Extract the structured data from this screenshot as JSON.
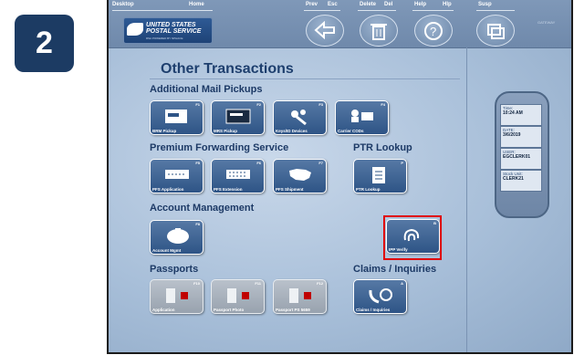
{
  "step_badge": "2",
  "topbar": {
    "desktop": "Desktop",
    "home": "Home",
    "prev": "Prev",
    "esc": "Esc",
    "delete": "Delete",
    "del": "Del",
    "help": "Help",
    "hlp": "Hlp",
    "susp": "Susp",
    "right_logo": "GATEWAY"
  },
  "logo": {
    "line1": "UNITED STATES",
    "line2": "POSTAL SERVICE",
    "line3": "RSA POWERED BY NPHACE"
  },
  "page_title": "Other Transactions",
  "sections": {
    "mail_pickups": "Additional Mail Pickups",
    "forwarding": "Premium Forwarding Service",
    "ptr": "PTR Lookup",
    "account": "Account Management",
    "passports": "Passports",
    "claims": "Claims / Inquiries"
  },
  "tiles": {
    "brm": {
      "key": "F1",
      "label": "BRM Pickup"
    },
    "mrs": {
      "key": "F2",
      "label": "MRS Pickup"
    },
    "keys": {
      "key": "F3",
      "label": "Keys/ID Devices"
    },
    "carrier": {
      "key": "F4",
      "label": "Carrier CODs"
    },
    "pfs_app": {
      "key": "F5",
      "label": "PFS Application"
    },
    "pfs_ext": {
      "key": "F6",
      "label": "PFS Extension"
    },
    "pfs_ship": {
      "key": "F7",
      "label": "PFS Shipment"
    },
    "ptr": {
      "key": "P",
      "label": "PTR Lookup"
    },
    "acct": {
      "key": "F8",
      "label": "Account Mgmt"
    },
    "ipp": {
      "key": "B",
      "label": "IPP Verify"
    },
    "pp_app": {
      "key": "F10",
      "label": "Application"
    },
    "pp_photo": {
      "key": "F11",
      "label": "Passport Photo"
    },
    "pp_ps": {
      "key": "F12",
      "label": "Passport PS 5659"
    },
    "claims": {
      "key": "A",
      "label": "Claims / Inquiries"
    }
  },
  "info_panel": {
    "time_label": "Time:",
    "time_value": "10:24 AM",
    "date_label": "DATE:",
    "date_value": "3/6/2019",
    "user_label": "USER:",
    "user_value": "EGCLERK01",
    "stock_label": "Stock Unit:",
    "stock_value": "CLERK21"
  },
  "colors": {
    "highlight": "#e00000",
    "badge": "#1c3b63",
    "title": "#1e3f6e"
  }
}
